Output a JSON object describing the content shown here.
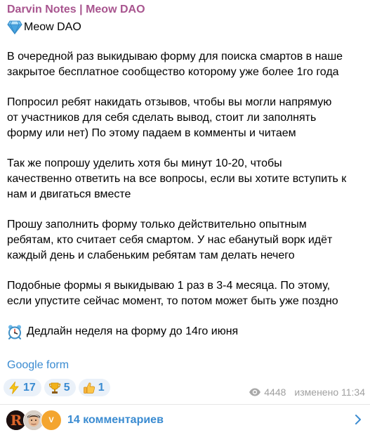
{
  "post": {
    "channel_name": "Darvin Notes | Meow DAO",
    "subtitle": "Meow DAO",
    "paragraphs": [
      [
        "В очередной раз выкидываю форму для поиска смартов в наше",
        "закрытое бесплатное сообщество которому уже более 1го года"
      ],
      [
        "Попросил ребят накидать отзывов, чтобы вы могли напрямую",
        "от участников для себя сделать вывод, стоит ли заполнять",
        "форму или нет) По этому падаем в комменты и читаем"
      ],
      [
        "Так же попрошу уделить хотя бы минут 10-20, чтобы",
        "качественно ответить на все вопросы, если вы хотите вступить к",
        "нам и двигаться вместе"
      ],
      [
        "Прошу заполнить форму только действительно опытным",
        "ребятам, кто считает себя смартом. У нас ебанутый ворк идёт",
        "каждый день и слабеньким ребятам там делать нечего"
      ],
      [
        "Подобные формы я выкидываю 1 раз в 3-4 месяца. По этому,",
        "если упустите сейчас момент, то потом может быть уже поздно"
      ]
    ],
    "deadline": "Дедлайн неделя на форму до 14го июня",
    "link_text": "Google form"
  },
  "reactions": [
    {
      "emoji": "zap-emoji",
      "count": "17"
    },
    {
      "emoji": "trophy-emoji",
      "count": "5"
    },
    {
      "emoji": "thumbs-up-emoji",
      "count": "1"
    }
  ],
  "meta": {
    "views": "4448",
    "edited": "изменено 11:34"
  },
  "comments": {
    "label": "14 комментариев",
    "avatar_letter": "V"
  },
  "colors": {
    "channel_name": "#a8558f",
    "link": "#3a8bd1",
    "reaction_bg": "#eaf1f9",
    "meta_text": "#a0a0a0"
  }
}
